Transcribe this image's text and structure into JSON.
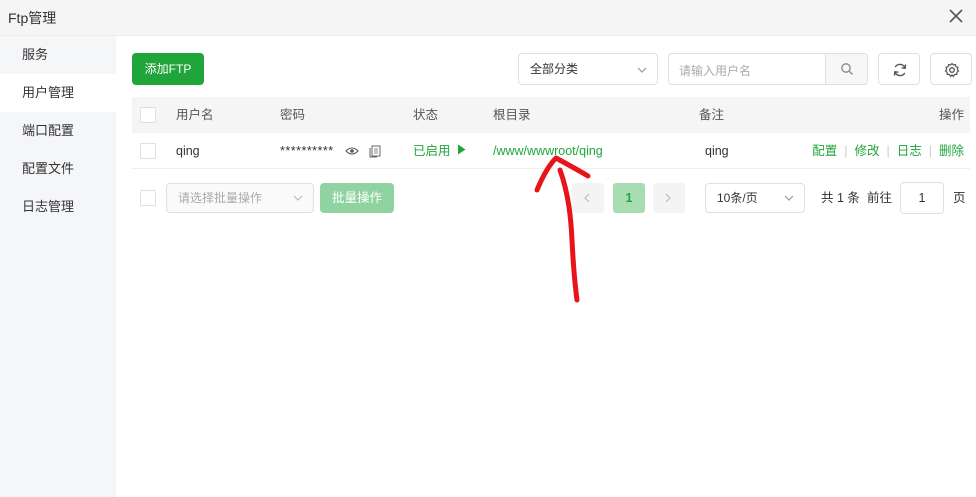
{
  "window": {
    "title": "Ftp管理"
  },
  "sidebar": {
    "items": [
      {
        "label": "服务",
        "active": false
      },
      {
        "label": "用户管理",
        "active": true
      },
      {
        "label": "端口配置",
        "active": false
      },
      {
        "label": "配置文件",
        "active": false
      },
      {
        "label": "日志管理",
        "active": false
      }
    ]
  },
  "toolbar": {
    "add_label": "添加FTP",
    "category_value": "全部分类",
    "search_placeholder": "请输入用户名"
  },
  "table": {
    "headers": {
      "user": "用户名",
      "password": "密码",
      "status": "状态",
      "root": "根目录",
      "note": "备注",
      "ops": "操作"
    },
    "rows": [
      {
        "user": "qing",
        "password": "**********",
        "status": "已启用",
        "root": "/www/wwwroot/qing",
        "note": "qing",
        "ops": [
          "配置",
          "修改",
          "日志",
          "删除"
        ]
      }
    ]
  },
  "footer": {
    "batch_placeholder": "请选择批量操作",
    "batch_button": "批量操作",
    "current_page": "1",
    "page_size": "10条/页",
    "total_text": "共 1 条",
    "goto_label": "前往",
    "goto_value": "1",
    "page_unit": "页"
  },
  "colors": {
    "accent": "#20a53a",
    "annotation": "#e8141c"
  }
}
